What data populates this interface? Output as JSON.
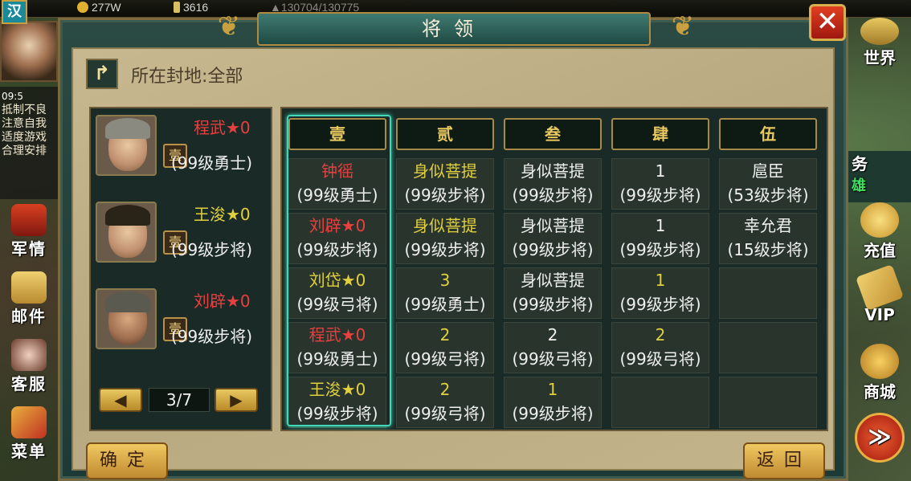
{
  "topbar": {
    "gold": "277W",
    "food": "3616",
    "hp": "▲130704/130775"
  },
  "left_sidebar": {
    "country": "汉",
    "info_time": "09:5",
    "info_lines": [
      "抵制不良",
      "注意自我",
      "适度游戏",
      "合理安排"
    ],
    "buttons": [
      {
        "label": "军情",
        "icon": "military-intel-icon"
      },
      {
        "label": "邮件",
        "icon": "mail-icon"
      },
      {
        "label": "客服",
        "icon": "support-icon"
      },
      {
        "label": "菜单",
        "icon": "menu-icon"
      }
    ]
  },
  "right_sidebar": {
    "world": "世界",
    "task": "务",
    "task_sub": "雄",
    "recharge": "充值",
    "vip": "VIP",
    "shop": "商城"
  },
  "dialog": {
    "title": "将领",
    "close": "✕",
    "location": "所在封地:全部",
    "confirm": "确定",
    "return": "返回"
  },
  "generals": [
    {
      "name": "程武",
      "star": "★0",
      "rank": "壹",
      "level": "(99级勇士)",
      "color": "red"
    },
    {
      "name": "王浚",
      "star": "★0",
      "rank": "壹",
      "level": "(99级步将)",
      "color": "gold"
    },
    {
      "name": "刘辟",
      "star": "★0",
      "rank": "壹",
      "level": "(99级步将)",
      "color": "red"
    }
  ],
  "pager": {
    "text": "3/7",
    "prev": "◀",
    "next": "▶"
  },
  "columns": [
    "壹",
    "贰",
    "叁",
    "肆",
    "伍"
  ],
  "grid": [
    [
      {
        "name": "钟徭",
        "level": "(99级勇士)",
        "color": "red"
      },
      {
        "name": "刘辟★0",
        "level": "(99级步将)",
        "color": "red"
      },
      {
        "name": "刘岱★0",
        "level": "(99级弓将)",
        "color": "gold"
      },
      {
        "name": "程武★0",
        "level": "(99级勇士)",
        "color": "red"
      },
      {
        "name": "王浚★0",
        "level": "(99级步将)",
        "color": "gold"
      }
    ],
    [
      {
        "name": "身似菩提",
        "level": "(99级步将)",
        "color": "gold"
      },
      {
        "name": "身似菩提",
        "level": "(99级步将)",
        "color": "gold"
      },
      {
        "name": "3",
        "level": "(99级勇士)",
        "color": "gold"
      },
      {
        "name": "2",
        "level": "(99级弓将)",
        "color": "gold"
      },
      {
        "name": "2",
        "level": "(99级弓将)",
        "color": "gold"
      }
    ],
    [
      {
        "name": "身似菩提",
        "level": "(99级步将)",
        "color": "white"
      },
      {
        "name": "身似菩提",
        "level": "(99级步将)",
        "color": "white"
      },
      {
        "name": "身似菩提",
        "level": "(99级步将)",
        "color": "white"
      },
      {
        "name": "2",
        "level": "(99级弓将)",
        "color": "white"
      },
      {
        "name": "1",
        "level": "(99级步将)",
        "color": "gold"
      }
    ],
    [
      {
        "name": "1",
        "level": "(99级步将)",
        "color": "white"
      },
      {
        "name": "1",
        "level": "(99级步将)",
        "color": "white"
      },
      {
        "name": "1",
        "level": "(99级步将)",
        "color": "gold"
      },
      {
        "name": "2",
        "level": "(99级弓将)",
        "color": "gold"
      },
      {
        "name": "",
        "level": "",
        "color": "white"
      }
    ],
    [
      {
        "name": "扈臣",
        "level": "(53级步将)",
        "color": "white"
      },
      {
        "name": "幸允君",
        "level": "(15级步将)",
        "color": "white"
      },
      {
        "name": "",
        "level": "",
        "color": "white"
      },
      {
        "name": "",
        "level": "",
        "color": "white"
      },
      {
        "name": "",
        "level": "",
        "color": "white"
      }
    ]
  ]
}
